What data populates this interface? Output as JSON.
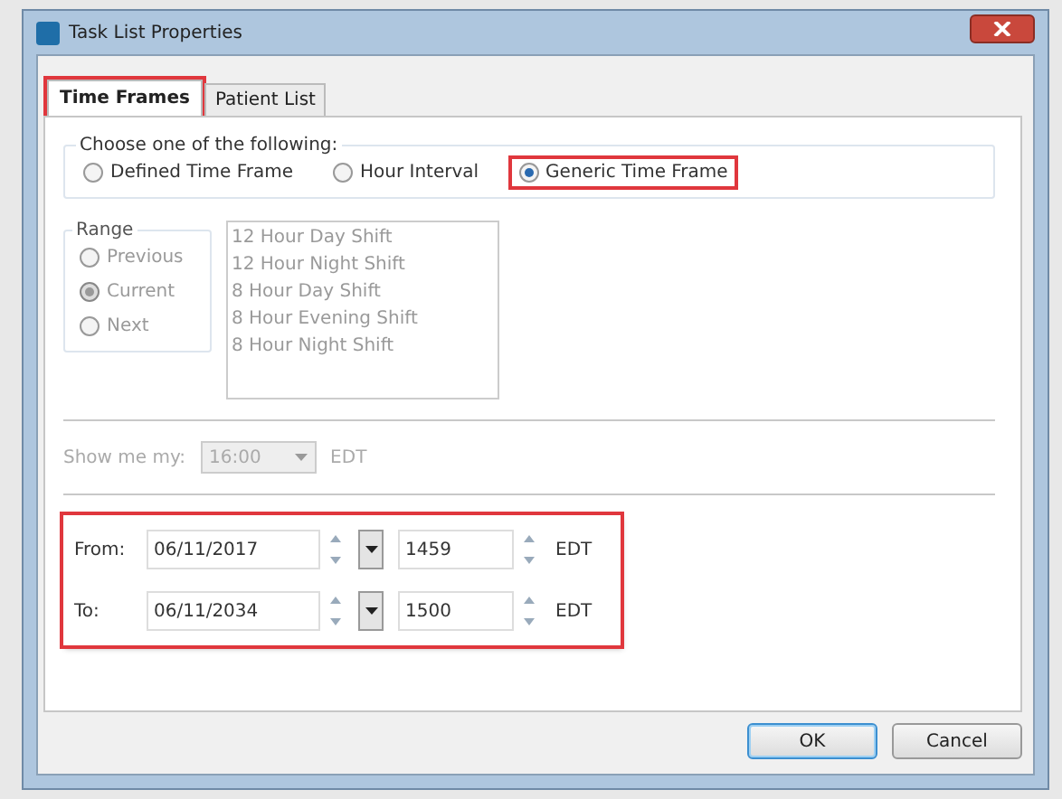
{
  "window": {
    "title": "Task List Properties"
  },
  "tabs": [
    {
      "label": "Time Frames",
      "selected": true,
      "highlighted": true
    },
    {
      "label": "Patient List",
      "selected": false,
      "highlighted": false
    }
  ],
  "choose_group": {
    "legend": "Choose one of the following:",
    "options": [
      {
        "label": "Defined Time Frame",
        "selected": false,
        "highlighted": false
      },
      {
        "label": "Hour Interval",
        "selected": false,
        "highlighted": false
      },
      {
        "label": "Generic Time Frame",
        "selected": true,
        "highlighted": true
      }
    ]
  },
  "range_group": {
    "legend": "Range",
    "disabled": true,
    "options": [
      {
        "label": "Previous",
        "selected": false
      },
      {
        "label": "Current",
        "selected": true
      },
      {
        "label": "Next",
        "selected": false
      }
    ]
  },
  "shift_list": {
    "disabled": true,
    "items": [
      "12 Hour Day Shift",
      "12 Hour Night Shift",
      "8 Hour Day Shift",
      "8 Hour Evening Shift",
      "8 Hour Night Shift"
    ]
  },
  "show_me": {
    "label": "Show me my:",
    "value": "16:00",
    "zone": "EDT",
    "disabled": true
  },
  "date_range": {
    "highlighted": true,
    "rows": [
      {
        "label": "From:",
        "date": "06/11/2017",
        "time": "1459",
        "zone": "EDT"
      },
      {
        "label": "To:",
        "date": "06/11/2034",
        "time": "1500",
        "zone": "EDT"
      }
    ]
  },
  "buttons": [
    {
      "label": "OK",
      "default": true
    },
    {
      "label": "Cancel",
      "default": false
    }
  ]
}
